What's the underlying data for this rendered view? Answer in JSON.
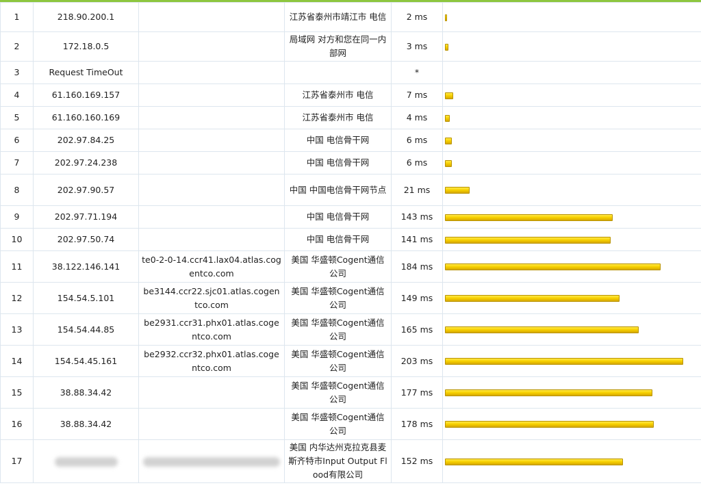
{
  "colors": {
    "top_border": "#8dc63f",
    "grid_line": "#dde6ee",
    "bar_fill": "#f8d200",
    "bar_edge": "#b89200"
  },
  "columns": [
    "hop",
    "ip",
    "hostname",
    "location",
    "latency",
    "latency_bar"
  ],
  "max_latency_ms_for_full_bar": 209,
  "rows": [
    {
      "hop": "1",
      "ip": "218.90.200.1",
      "hostname": "",
      "location": "江苏省泰州市靖江市 电信",
      "latency": "2 ms",
      "latency_ms": 2
    },
    {
      "hop": "2",
      "ip": "172.18.0.5",
      "hostname": "",
      "location": "局域网 对方和您在同一内部网",
      "latency": "3 ms",
      "latency_ms": 3
    },
    {
      "hop": "3",
      "ip": "Request TimeOut",
      "hostname": "",
      "location": "",
      "latency": "*",
      "latency_ms": 0
    },
    {
      "hop": "4",
      "ip": "61.160.169.157",
      "hostname": "",
      "location": "江苏省泰州市 电信",
      "latency": "7 ms",
      "latency_ms": 7
    },
    {
      "hop": "5",
      "ip": "61.160.160.169",
      "hostname": "",
      "location": "江苏省泰州市 电信",
      "latency": "4 ms",
      "latency_ms": 4
    },
    {
      "hop": "6",
      "ip": "202.97.84.25",
      "hostname": "",
      "location": "中国 电信骨干网",
      "latency": "6 ms",
      "latency_ms": 6
    },
    {
      "hop": "7",
      "ip": "202.97.24.238",
      "hostname": "",
      "location": "中国 电信骨干网",
      "latency": "6 ms",
      "latency_ms": 6
    },
    {
      "hop": "8",
      "ip": "202.97.90.57",
      "hostname": "",
      "location": "中国 中国电信骨干网节点",
      "latency": "21 ms",
      "latency_ms": 21
    },
    {
      "hop": "9",
      "ip": "202.97.71.194",
      "hostname": "",
      "location": "中国 电信骨干网",
      "latency": "143 ms",
      "latency_ms": 143
    },
    {
      "hop": "10",
      "ip": "202.97.50.74",
      "hostname": "",
      "location": "中国 电信骨干网",
      "latency": "141 ms",
      "latency_ms": 141
    },
    {
      "hop": "11",
      "ip": "38.122.146.141",
      "hostname": "te0-2-0-14.ccr41.lax04.atlas.cogentco.com",
      "location": "美国 华盛顿Cogent通信公司",
      "latency": "184 ms",
      "latency_ms": 184
    },
    {
      "hop": "12",
      "ip": "154.54.5.101",
      "hostname": "be3144.ccr22.sjc01.atlas.cogentco.com",
      "location": "美国 华盛顿Cogent通信公司",
      "latency": "149 ms",
      "latency_ms": 149
    },
    {
      "hop": "13",
      "ip": "154.54.44.85",
      "hostname": "be2931.ccr31.phx01.atlas.cogentco.com",
      "location": "美国 华盛顿Cogent通信公司",
      "latency": "165 ms",
      "latency_ms": 165
    },
    {
      "hop": "14",
      "ip": "154.54.45.161",
      "hostname": "be2932.ccr32.phx01.atlas.cogentco.com",
      "location": "美国 华盛顿Cogent通信公司",
      "latency": "203 ms",
      "latency_ms": 203
    },
    {
      "hop": "15",
      "ip": "38.88.34.42",
      "hostname": "",
      "location": "美国 华盛顿Cogent通信公司",
      "latency": "177 ms",
      "latency_ms": 177
    },
    {
      "hop": "16",
      "ip": "38.88.34.42",
      "hostname": "",
      "location": "美国 华盛顿Cogent通信公司",
      "latency": "178 ms",
      "latency_ms": 178
    },
    {
      "hop": "17",
      "ip": "",
      "hostname": "",
      "location": "美国 内华达州克拉克县麦斯齐特市Input Output Flood有限公司",
      "latency": "152 ms",
      "latency_ms": 152,
      "redacted": true
    }
  ]
}
